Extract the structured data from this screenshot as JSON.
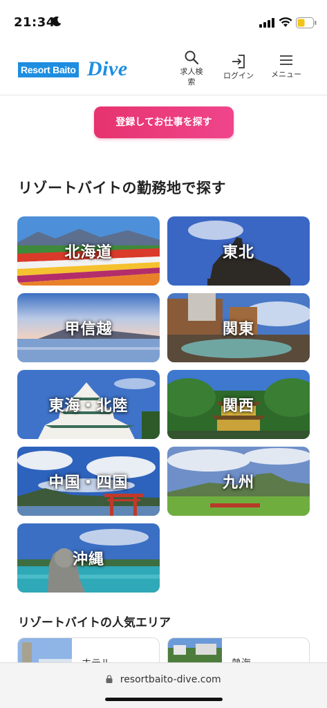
{
  "status": {
    "time": "21:34"
  },
  "header": {
    "logo_text": "Resort Baito",
    "logo_script": "Dive",
    "nav": {
      "search": "求人検索",
      "login": "ログイン",
      "menu": "メニュー"
    }
  },
  "cta": {
    "label": "登録してお仕事を探す"
  },
  "section": {
    "title": "リゾートバイトの勤務地で探す"
  },
  "regions": [
    {
      "label": "北海道"
    },
    {
      "label": "東北"
    },
    {
      "label": "甲信越"
    },
    {
      "label": "関東"
    },
    {
      "label": "東海・北陸"
    },
    {
      "label": "関西"
    },
    {
      "label": "中国・四国"
    },
    {
      "label": "九州"
    },
    {
      "label": "沖縄"
    }
  ],
  "popular": {
    "title": "リゾートバイトの人気エリア",
    "cards": [
      {
        "name": "ホテル"
      },
      {
        "name": "熱海"
      }
    ]
  },
  "browser": {
    "url": "resortbaito-dive.com"
  },
  "colors": {
    "brand": "#1e8ee0",
    "cta": "#e6336e"
  }
}
